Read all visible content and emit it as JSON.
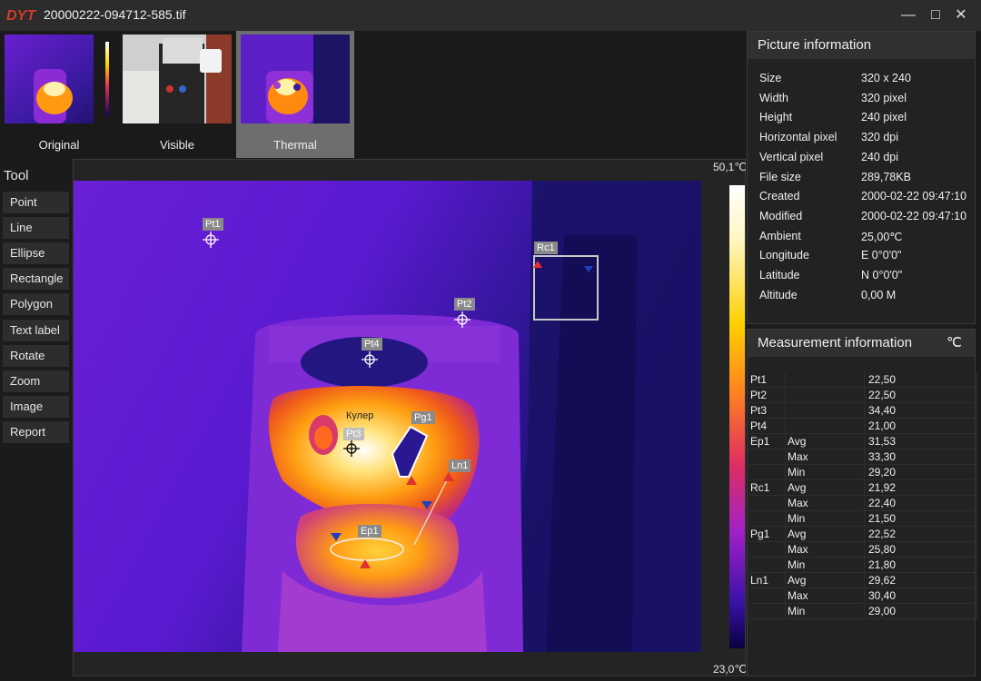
{
  "app": {
    "title": "20000222-094712-585.tif",
    "logo": "DYT",
    "window_controls": [
      "minimize-icon",
      "maximize-icon",
      "close-icon"
    ]
  },
  "thumbnails": [
    {
      "label": "Original",
      "active": false
    },
    {
      "label": "Visible",
      "active": false
    },
    {
      "label": "Thermal",
      "active": true
    }
  ],
  "tool": {
    "header": "Tool",
    "items": [
      "Point",
      "Line",
      "Ellipse",
      "Rectangle",
      "Polygon",
      "Text label",
      "Rotate",
      "Zoom",
      "Image",
      "Report"
    ]
  },
  "scale": {
    "max": "50,1℃",
    "min": "23,0℃"
  },
  "overlay": {
    "markers": [
      "Pt1",
      "Pt2",
      "Pt3",
      "Pt4",
      "Rc1",
      "Pg1",
      "Ln1",
      "Ep1"
    ],
    "text_label": "Кулер"
  },
  "picture_info": {
    "header": "Picture information",
    "rows": [
      {
        "label": "Size",
        "value": "320 x 240"
      },
      {
        "label": "Width",
        "value": "320 pixel"
      },
      {
        "label": "Height",
        "value": "240 pixel"
      },
      {
        "label": "Horizontal pixel",
        "value": "320 dpi"
      },
      {
        "label": "Vertical pixel",
        "value": "240 dpi"
      },
      {
        "label": "File size",
        "value": "289,78KB"
      },
      {
        "label": "Created",
        "value": "2000-02-22 09:47:10"
      },
      {
        "label": "Modified",
        "value": "2000-02-22 09:47:10"
      },
      {
        "label": "Ambient",
        "value": "25,00℃"
      },
      {
        "label": "Longitude",
        "value": "E 0°0'0\""
      },
      {
        "label": "Latitude",
        "value": "N 0°0'0\""
      },
      {
        "label": "Altitude",
        "value": "0,00 M"
      }
    ]
  },
  "measurement_info": {
    "header": "Measurement information",
    "unit": "℃",
    "rows": [
      {
        "name": "Pt1",
        "stat": "",
        "value": "22,50"
      },
      {
        "name": "Pt2",
        "stat": "",
        "value": "22,50"
      },
      {
        "name": "Pt3",
        "stat": "",
        "value": "34,40"
      },
      {
        "name": "Pt4",
        "stat": "",
        "value": "21,00"
      },
      {
        "name": "Ep1",
        "stat": "Avg",
        "value": "31,53"
      },
      {
        "name": "",
        "stat": "Max",
        "value": "33,30"
      },
      {
        "name": "",
        "stat": "Min",
        "value": "29,20"
      },
      {
        "name": "Rc1",
        "stat": "Avg",
        "value": "21,92"
      },
      {
        "name": "",
        "stat": "Max",
        "value": "22,40"
      },
      {
        "name": "",
        "stat": "Min",
        "value": "21,50"
      },
      {
        "name": "Pg1",
        "stat": "Avg",
        "value": "22,52"
      },
      {
        "name": "",
        "stat": "Max",
        "value": "25,80"
      },
      {
        "name": "",
        "stat": "Min",
        "value": "21,80"
      },
      {
        "name": "Ln1",
        "stat": "Avg",
        "value": "29,62"
      },
      {
        "name": "",
        "stat": "Max",
        "value": "30,40"
      },
      {
        "name": "",
        "stat": "Min",
        "value": "29,00"
      }
    ]
  }
}
